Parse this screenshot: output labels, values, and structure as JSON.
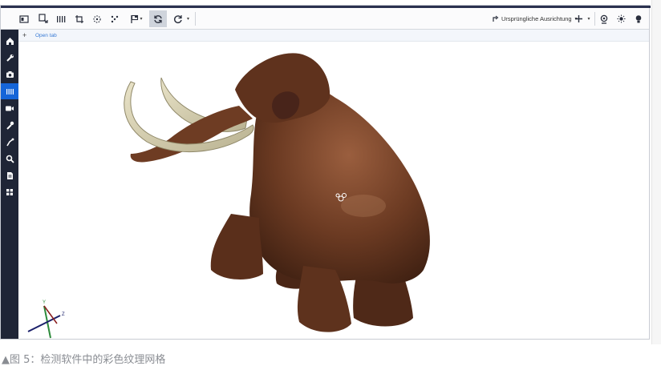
{
  "toolbar": {
    "orientation_label": "Ursprüngliche Ausrichtung",
    "caret": "▾"
  },
  "tabs": {
    "add_label": "+",
    "open_tab_label": "Open tab"
  },
  "caption": "▲图 5：检测软件中的彩色纹理网格",
  "colors": {
    "sidebar_bg": "#1f2536",
    "sidebar_active": "#1565d8",
    "toolbar_active": "#cfd4dc",
    "model_brown": "#6b3a22",
    "tusk": "#d9d2b4"
  }
}
